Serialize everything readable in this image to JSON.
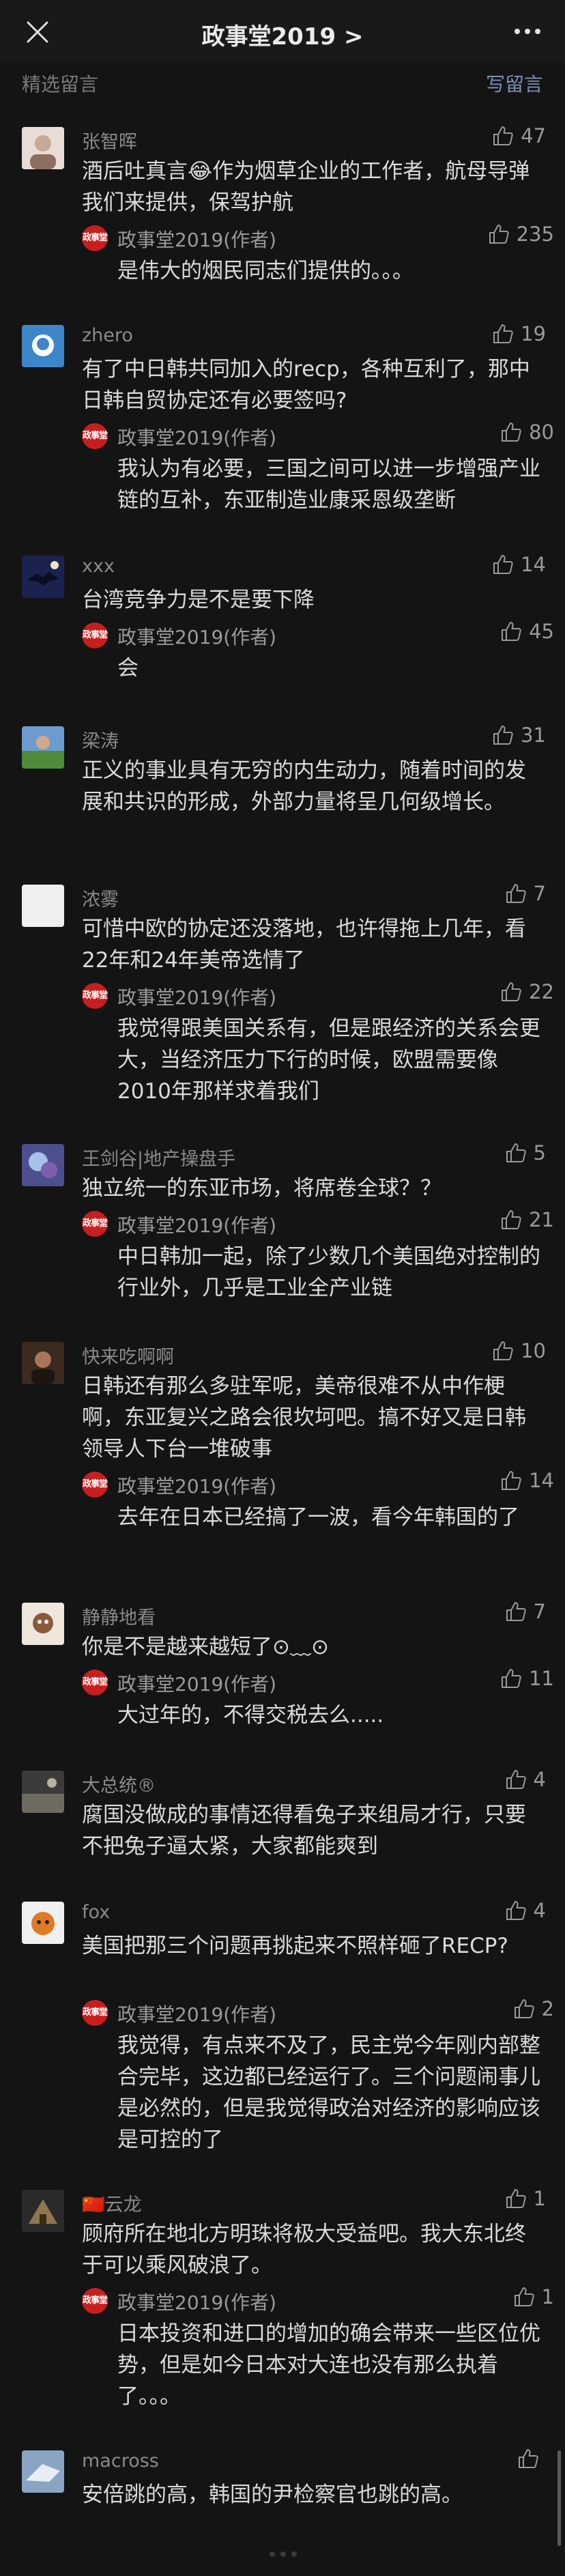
{
  "header": {
    "title": "政事堂2019 >",
    "close_icon": "close-icon",
    "more_icon": "more-dots-icon"
  },
  "subbar": {
    "left": "精选留言",
    "right": "写留言"
  },
  "reply_badge_text": "政事堂",
  "colors": {
    "background": "#141414",
    "badge": "#c71f1f",
    "link": "#7d8fb3"
  },
  "comments": [
    {
      "name": "张智晖",
      "likes": "47",
      "text": "酒后吐真言😂作为烟草企业的工作者，航母导弹我们来提供，保驾护航",
      "reply": {
        "name": "政事堂2019(作者)",
        "likes": "235",
        "text": "是伟大的烟民同志们提供的。。。"
      }
    },
    {
      "name": "zhero",
      "likes": "19",
      "text": "有了中日韩共同加入的recp，各种互利了，那中日韩自贸协定还有必要签吗?",
      "reply": {
        "name": "政事堂2019(作者)",
        "likes": "80",
        "text": "我认为有必要，三国之间可以进一步增强产业链的互补，东亚制造业康采恩级垄断"
      }
    },
    {
      "name": "xxx",
      "likes": "14",
      "text": "台湾竞争力是不是要下降",
      "reply": {
        "name": "政事堂2019(作者)",
        "likes": "45",
        "text": "会"
      }
    },
    {
      "name": "梁涛",
      "likes": "31",
      "text": "正义的事业具有无穷的内生动力，随着时间的发展和共识的形成，外部力量将呈几何级增长。"
    },
    {
      "name": "浓雾",
      "likes": "7",
      "text": "可惜中欧的协定还没落地，也许得拖上几年，看22年和24年美帝选情了",
      "reply": {
        "name": "政事堂2019(作者)",
        "likes": "22",
        "text": "我觉得跟美国关系有，但是跟经济的关系会更大，当经济压力下行的时候，欧盟需要像2010年那样求着我们"
      }
    },
    {
      "name": "王剑谷|地产操盘手",
      "likes": "5",
      "text": "独立统一的东亚市场，将席卷全球？？",
      "reply": {
        "name": "政事堂2019(作者)",
        "likes": "21",
        "text": "中日韩加一起，除了少数几个美国绝对控制的行业外，几乎是工业全产业链"
      }
    },
    {
      "name": "快来吃啊啊",
      "likes": "10",
      "text": "日韩还有那么多驻军呢，美帝很难不从中作梗啊，东亚复兴之路会很坎坷吧。搞不好又是日韩领导人下台一堆破事",
      "reply": {
        "name": "政事堂2019(作者)",
        "likes": "14",
        "text": "去年在日本已经搞了一波，看今年韩国的了"
      }
    },
    {
      "name": "静静地看",
      "likes": "7",
      "text": "你是不是越来越短了⊙﹏⊙",
      "reply": {
        "name": "政事堂2019(作者)",
        "likes": "11",
        "text": "大过年的，不得交税去么....."
      }
    },
    {
      "name": "大总统®",
      "likes": "4",
      "text": "腐国没做成的事情还得看兔子来组局才行，只要不把兔子逼太紧，大家都能爽到"
    },
    {
      "name": "fox",
      "likes": "4",
      "text": "美国把那三个问题再挑起来不照样砸了RECP?",
      "reply": {
        "name": "政事堂2019(作者)",
        "likes": "2",
        "text": "我觉得，有点来不及了，民主党今年刚内部整合完毕，这边都已经运行了。三个问题闹事儿是必然的，但是我觉得政治对经济的影响应该是可控的了"
      }
    },
    {
      "name": "🇨🇳云龙",
      "likes": "1",
      "text": "顾府所在地北方明珠将极大受益吧。我大东北终于可以乘风破浪了。",
      "reply": {
        "name": "政事堂2019(作者)",
        "likes": "1",
        "text": "日本投资和进口的增加的确会带来一些区位优势，但是如今日本对大连也没有那么执着了。。。"
      }
    },
    {
      "name": "macross",
      "likes": "",
      "text": "安倍跳的高，韩国的尹检察官也跳的高。"
    }
  ]
}
